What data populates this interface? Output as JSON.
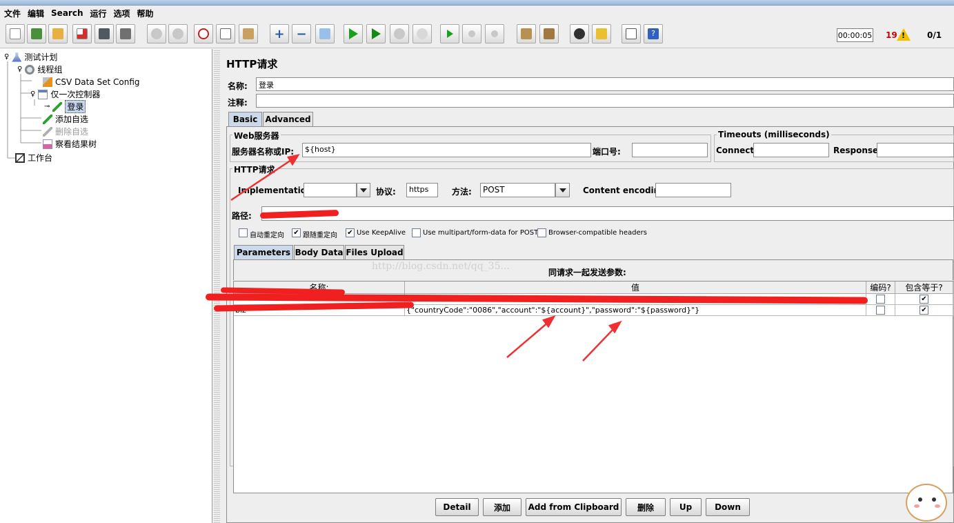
{
  "menu": [
    "文件",
    "编辑",
    "Search",
    "运行",
    "选项",
    "帮助"
  ],
  "status": {
    "timer": "00:00:05",
    "errors": "19",
    "threads": "0/1"
  },
  "tree": {
    "test_plan": "测试计划",
    "thread_group": "线程组",
    "csv_config": "CSV Data Set Config",
    "once_controller": "仅一次控制器",
    "login": "登录",
    "add_watch": "添加自选",
    "delete_watch": "删除自选",
    "results_tree": "察看结果树",
    "workbench": "工作台"
  },
  "form": {
    "title": "HTTP请求",
    "name_label": "名称:",
    "name_value": "登录",
    "comment_label": "注释:",
    "comment_value": "",
    "tabs": [
      "Basic",
      "Advanced"
    ],
    "web_server": "Web服务器",
    "server_label": "服务器名称或IP:",
    "server_value": "${host}",
    "port_label": "端口号:",
    "port_value": "",
    "timeouts": "Timeouts (milliseconds)",
    "connect_label": "Connect:",
    "response_label": "Response:",
    "http_request": "HTTP请求",
    "impl_label": "Implementation:",
    "impl_value": "",
    "protocol_label": "协议:",
    "protocol_value": "https",
    "method_label": "方法:",
    "method_value": "POST",
    "encoding_label": "Content encoding:",
    "encoding_value": "",
    "path_label": "路径:",
    "options": [
      {
        "label": "自动重定向",
        "checked": false
      },
      {
        "label": "跟随重定向",
        "checked": true
      },
      {
        "label": "Use KeepAlive",
        "checked": true
      },
      {
        "label": "Use multipart/form-data for POST",
        "checked": false
      },
      {
        "label": "Browser-compatible headers",
        "checked": false
      }
    ],
    "param_tabs": [
      "Parameters",
      "Body Data",
      "Files Upload"
    ],
    "table_title": "同请求一起发送参数:",
    "columns": [
      "名称:",
      "值",
      "编码?",
      "包含等于?"
    ],
    "rows": [
      {
        "name": "",
        "value": "",
        "encode": false,
        "include_equals": true
      },
      {
        "name": "biz",
        "value": "{\"countryCode\":\"0086\",\"account\":\"${account}\",\"password\":\"${password}\"}",
        "encode": false,
        "include_equals": true
      }
    ],
    "buttons": [
      "Detail",
      "添加",
      "Add from Clipboard",
      "删除",
      "Up",
      "Down"
    ],
    "watermark": "http://blog.csdn.net/qq_35..."
  }
}
